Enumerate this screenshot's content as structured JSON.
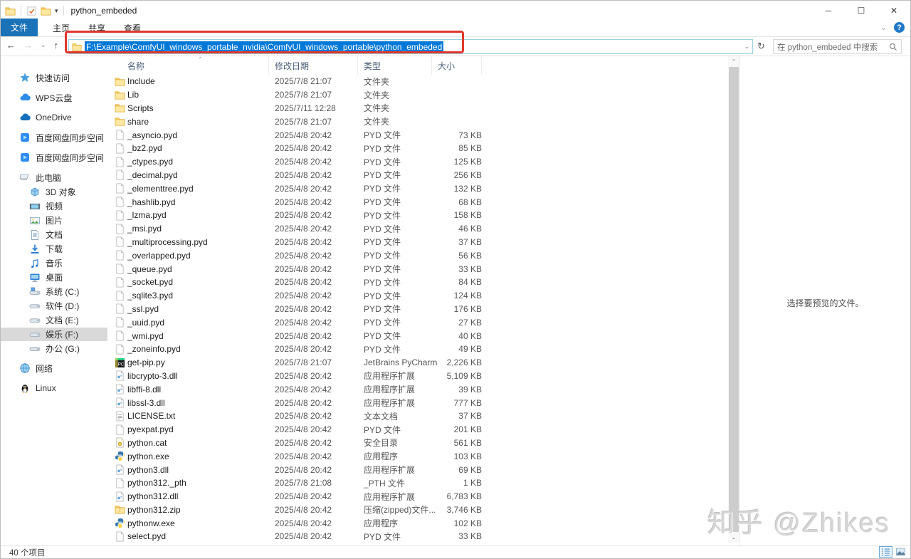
{
  "window": {
    "title": "python_embeded"
  },
  "window_controls": {
    "minimize": "─",
    "maximize": "☐",
    "close": "✕"
  },
  "ribbon": {
    "tabs": [
      "文件",
      "主页",
      "共享",
      "查看"
    ]
  },
  "address": {
    "path": "F:\\Example\\ComfyUI_windows_portable_nvidia\\ComfyUI_windows_portable\\python_embeded"
  },
  "search": {
    "placeholder": "在 python_embeded 中搜索"
  },
  "sidebar": {
    "items": [
      {
        "label": "快速访问",
        "icon": "quick-access",
        "level": 0
      },
      {
        "label": "WPS云盘",
        "icon": "wps-cloud",
        "level": 0
      },
      {
        "label": "OneDrive",
        "icon": "onedrive",
        "level": 0
      },
      {
        "label": "百度网盘同步空间",
        "icon": "baidu-netdisk",
        "level": 0
      },
      {
        "label": "百度网盘同步空间",
        "icon": "baidu-netdisk",
        "level": 0
      },
      {
        "label": "此电脑",
        "icon": "this-pc",
        "level": 0
      },
      {
        "label": "3D 对象",
        "icon": "objects-3d",
        "level": 1
      },
      {
        "label": "视频",
        "icon": "videos",
        "level": 1
      },
      {
        "label": "图片",
        "icon": "pictures",
        "level": 1
      },
      {
        "label": "文档",
        "icon": "documents",
        "level": 1
      },
      {
        "label": "下载",
        "icon": "downloads",
        "level": 1
      },
      {
        "label": "音乐",
        "icon": "music",
        "level": 1
      },
      {
        "label": "桌面",
        "icon": "desktop",
        "level": 1
      },
      {
        "label": "系统 (C:)",
        "icon": "drive-system",
        "level": 1
      },
      {
        "label": "软件 (D:)",
        "icon": "drive",
        "level": 1
      },
      {
        "label": "文档 (E:)",
        "icon": "drive",
        "level": 1
      },
      {
        "label": "娱乐 (F:)",
        "icon": "drive",
        "level": 1,
        "selected": true
      },
      {
        "label": "办公 (G:)",
        "icon": "drive",
        "level": 1
      },
      {
        "label": "网络",
        "icon": "network",
        "level": 0
      },
      {
        "label": "Linux",
        "icon": "linux",
        "level": 0
      }
    ]
  },
  "filelist": {
    "columns": [
      "名称",
      "修改日期",
      "类型",
      "大小"
    ],
    "rows": [
      {
        "name": "Include",
        "date": "2025/7/8 21:07",
        "type": "文件夹",
        "size": "",
        "icon": "folder"
      },
      {
        "name": "Lib",
        "date": "2025/7/8 21:07",
        "type": "文件夹",
        "size": "",
        "icon": "folder"
      },
      {
        "name": "Scripts",
        "date": "2025/7/11 12:28",
        "type": "文件夹",
        "size": "",
        "icon": "folder"
      },
      {
        "name": "share",
        "date": "2025/7/8 21:07",
        "type": "文件夹",
        "size": "",
        "icon": "folder"
      },
      {
        "name": "_asyncio.pyd",
        "date": "2025/4/8 20:42",
        "type": "PYD 文件",
        "size": "73 KB",
        "icon": "file"
      },
      {
        "name": "_bz2.pyd",
        "date": "2025/4/8 20:42",
        "type": "PYD 文件",
        "size": "85 KB",
        "icon": "file"
      },
      {
        "name": "_ctypes.pyd",
        "date": "2025/4/8 20:42",
        "type": "PYD 文件",
        "size": "125 KB",
        "icon": "file"
      },
      {
        "name": "_decimal.pyd",
        "date": "2025/4/8 20:42",
        "type": "PYD 文件",
        "size": "256 KB",
        "icon": "file"
      },
      {
        "name": "_elementtree.pyd",
        "date": "2025/4/8 20:42",
        "type": "PYD 文件",
        "size": "132 KB",
        "icon": "file"
      },
      {
        "name": "_hashlib.pyd",
        "date": "2025/4/8 20:42",
        "type": "PYD 文件",
        "size": "68 KB",
        "icon": "file"
      },
      {
        "name": "_lzma.pyd",
        "date": "2025/4/8 20:42",
        "type": "PYD 文件",
        "size": "158 KB",
        "icon": "file"
      },
      {
        "name": "_msi.pyd",
        "date": "2025/4/8 20:42",
        "type": "PYD 文件",
        "size": "46 KB",
        "icon": "file"
      },
      {
        "name": "_multiprocessing.pyd",
        "date": "2025/4/8 20:42",
        "type": "PYD 文件",
        "size": "37 KB",
        "icon": "file"
      },
      {
        "name": "_overlapped.pyd",
        "date": "2025/4/8 20:42",
        "type": "PYD 文件",
        "size": "56 KB",
        "icon": "file"
      },
      {
        "name": "_queue.pyd",
        "date": "2025/4/8 20:42",
        "type": "PYD 文件",
        "size": "33 KB",
        "icon": "file"
      },
      {
        "name": "_socket.pyd",
        "date": "2025/4/8 20:42",
        "type": "PYD 文件",
        "size": "84 KB",
        "icon": "file"
      },
      {
        "name": "_sqlite3.pyd",
        "date": "2025/4/8 20:42",
        "type": "PYD 文件",
        "size": "124 KB",
        "icon": "file"
      },
      {
        "name": "_ssl.pyd",
        "date": "2025/4/8 20:42",
        "type": "PYD 文件",
        "size": "176 KB",
        "icon": "file"
      },
      {
        "name": "_uuid.pyd",
        "date": "2025/4/8 20:42",
        "type": "PYD 文件",
        "size": "27 KB",
        "icon": "file"
      },
      {
        "name": "_wmi.pyd",
        "date": "2025/4/8 20:42",
        "type": "PYD 文件",
        "size": "40 KB",
        "icon": "file"
      },
      {
        "name": "_zoneinfo.pyd",
        "date": "2025/4/8 20:42",
        "type": "PYD 文件",
        "size": "49 KB",
        "icon": "file"
      },
      {
        "name": "get-pip.py",
        "date": "2025/7/8 21:07",
        "type": "JetBrains PyCharm",
        "size": "2,226 KB",
        "icon": "pycharm"
      },
      {
        "name": "libcrypto-3.dll",
        "date": "2025/4/8 20:42",
        "type": "应用程序扩展",
        "size": "5,109 KB",
        "icon": "dll"
      },
      {
        "name": "libffi-8.dll",
        "date": "2025/4/8 20:42",
        "type": "应用程序扩展",
        "size": "39 KB",
        "icon": "dll"
      },
      {
        "name": "libssl-3.dll",
        "date": "2025/4/8 20:42",
        "type": "应用程序扩展",
        "size": "777 KB",
        "icon": "dll"
      },
      {
        "name": "LICENSE.txt",
        "date": "2025/4/8 20:42",
        "type": "文本文档",
        "size": "37 KB",
        "icon": "txt"
      },
      {
        "name": "pyexpat.pyd",
        "date": "2025/4/8 20:42",
        "type": "PYD 文件",
        "size": "201 KB",
        "icon": "file"
      },
      {
        "name": "python.cat",
        "date": "2025/4/8 20:42",
        "type": "安全目录",
        "size": "561 KB",
        "icon": "cat"
      },
      {
        "name": "python.exe",
        "date": "2025/4/8 20:42",
        "type": "应用程序",
        "size": "103 KB",
        "icon": "python"
      },
      {
        "name": "python3.dll",
        "date": "2025/4/8 20:42",
        "type": "应用程序扩展",
        "size": "69 KB",
        "icon": "dll"
      },
      {
        "name": "python312._pth",
        "date": "2025/7/8 21:08",
        "type": "_PTH 文件",
        "size": "1 KB",
        "icon": "file"
      },
      {
        "name": "python312.dll",
        "date": "2025/4/8 20:42",
        "type": "应用程序扩展",
        "size": "6,783 KB",
        "icon": "dll"
      },
      {
        "name": "python312.zip",
        "date": "2025/4/8 20:42",
        "type": "压缩(zipped)文件...",
        "size": "3,746 KB",
        "icon": "zip"
      },
      {
        "name": "pythonw.exe",
        "date": "2025/4/8 20:42",
        "type": "应用程序",
        "size": "102 KB",
        "icon": "python"
      },
      {
        "name": "select.pyd",
        "date": "2025/4/8 20:42",
        "type": "PYD 文件",
        "size": "33 KB",
        "icon": "file"
      }
    ]
  },
  "preview": {
    "text": "选择要预览的文件。"
  },
  "statusbar": {
    "items_count": "40 个项目"
  },
  "watermark": "知乎 @Zhikes",
  "colors": {
    "accent": "#0078d7",
    "file_tab": "#1a72b8",
    "annotation": "#e0372c",
    "folder": "#ffd76e",
    "selection_text": "#ffffff"
  }
}
